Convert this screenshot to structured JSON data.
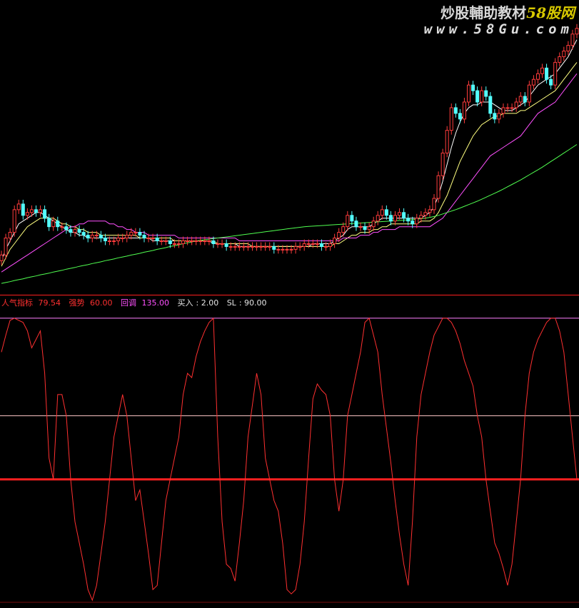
{
  "watermark": {
    "site_cn": "炒股輔助教材",
    "site_num": "58",
    "site_cn2": "股网",
    "url": "www.58Gu.com"
  },
  "colors": {
    "background": "#000000",
    "up_candle": "#ff3c3c",
    "down_candle": "#54ffff",
    "ma_short": "#ffffff",
    "ma_mid": "#ffff80",
    "ma_long": "#ff50ff",
    "ma_longest": "#50ff50",
    "indicator": "#ff3030",
    "level_line": "#ff2020",
    "ref_line": "#ffc8c8",
    "top_line": "#ff80ff",
    "divider": "#ff2020"
  },
  "legend": {
    "name_label": "人气指标",
    "name_value": "79.54",
    "strong_label": "强势",
    "strong_value": "60.00",
    "pullback_label": "回调",
    "pullback_value": "135.00",
    "buy_label": "买入",
    "buy_value": "2.00",
    "sl_label": "SL",
    "sl_value": "90.00"
  },
  "chart_data": [
    {
      "type": "candlestick",
      "title": "",
      "ylim": [
        0,
        100
      ],
      "x": [
        0,
        1,
        2,
        3,
        4,
        5,
        6,
        7,
        8,
        9,
        10,
        11,
        12,
        13,
        14,
        15,
        16,
        17,
        18,
        19,
        20,
        21,
        22,
        23,
        24,
        25,
        26,
        27,
        28,
        29,
        30,
        31,
        32,
        33,
        34,
        35,
        36,
        37,
        38,
        39,
        40,
        41,
        42,
        43,
        44,
        45,
        46,
        47,
        48,
        49,
        50,
        51,
        52,
        53,
        54,
        55,
        56,
        57,
        58,
        59,
        60,
        61,
        62,
        63,
        64,
        65,
        66,
        67,
        68,
        69,
        70,
        71,
        72,
        73,
        74,
        75,
        76,
        77,
        78,
        79,
        80,
        81,
        82,
        83,
        84,
        85,
        86,
        87,
        88,
        89,
        90,
        91,
        92,
        93,
        94,
        95,
        96,
        97,
        98,
        99,
        100,
        101,
        102,
        103,
        104,
        105,
        106,
        107,
        108,
        109,
        110,
        111,
        112,
        113,
        114,
        115,
        116,
        117,
        118,
        119,
        120,
        121,
        122,
        123,
        124,
        125,
        126,
        127,
        128,
        129,
        130,
        131,
        132,
        133
      ],
      "close": [
        12,
        18,
        20,
        28,
        30,
        26,
        27,
        28,
        27,
        28,
        25,
        22,
        24,
        22,
        22,
        21,
        20,
        21,
        20,
        19,
        18,
        19,
        19,
        18,
        17,
        17,
        17,
        18,
        18,
        19,
        20,
        20,
        19,
        18,
        18,
        18,
        17,
        17,
        17,
        16,
        16,
        16,
        17,
        17,
        17,
        17,
        17,
        17,
        17,
        16,
        16,
        16,
        15,
        15,
        15,
        15,
        15,
        15,
        15,
        15,
        15,
        15,
        15,
        14,
        14,
        14,
        14,
        14,
        15,
        15,
        16,
        16,
        16,
        16,
        15,
        15,
        16,
        18,
        20,
        22,
        26,
        24,
        22,
        22,
        21,
        22,
        24,
        26,
        28,
        26,
        24,
        26,
        27,
        25,
        24,
        23,
        25,
        26,
        27,
        28,
        32,
        40,
        48,
        56,
        64,
        62,
        60,
        66,
        72,
        70,
        66,
        70,
        68,
        62,
        60,
        62,
        64,
        64,
        64,
        66,
        68,
        66,
        72,
        74,
        76,
        78,
        74,
        72,
        80,
        82,
        84,
        86,
        90,
        92
      ],
      "series": [
        {
          "name": "",
          "values": [
            10,
            14,
            17,
            20,
            23,
            24,
            25,
            26,
            27,
            27,
            26,
            25,
            24,
            23,
            22,
            21,
            20,
            20,
            19,
            19,
            18,
            18,
            18,
            18,
            18,
            18,
            18,
            18,
            18,
            18,
            18,
            18,
            18,
            18,
            18,
            17,
            17,
            17,
            17,
            17,
            17,
            17,
            17,
            17,
            17,
            17,
            17,
            17,
            17,
            16,
            16,
            16,
            16,
            16,
            16,
            15,
            15,
            15,
            15,
            15,
            15,
            15,
            15,
            15,
            15,
            15,
            15,
            15,
            15,
            15,
            15,
            15,
            16,
            16,
            16,
            16,
            16,
            17,
            18,
            19,
            21,
            22,
            22,
            22,
            22,
            22,
            23,
            24,
            25,
            25,
            25,
            25,
            25,
            25,
            25,
            25,
            25,
            25,
            26,
            27,
            29,
            33,
            38,
            44,
            50,
            55,
            59,
            62,
            64,
            65,
            65,
            66,
            66,
            66,
            65,
            64,
            63,
            63,
            63,
            64,
            65,
            66,
            68,
            70,
            72,
            73,
            74,
            75,
            76,
            78,
            80,
            82,
            85,
            88
          ]
        },
        {
          "name": "",
          "values": [
            8,
            11,
            14,
            16,
            18,
            20,
            22,
            23,
            24,
            25,
            25,
            25,
            25,
            24,
            23,
            23,
            22,
            22,
            21,
            21,
            20,
            20,
            20,
            19,
            19,
            19,
            19,
            19,
            19,
            19,
            19,
            19,
            18,
            18,
            18,
            18,
            18,
            18,
            18,
            18,
            17,
            17,
            17,
            17,
            17,
            17,
            17,
            17,
            17,
            17,
            16,
            16,
            16,
            16,
            16,
            16,
            16,
            16,
            15,
            15,
            15,
            15,
            15,
            15,
            15,
            15,
            15,
            15,
            15,
            15,
            15,
            15,
            15,
            15,
            15,
            15,
            15,
            16,
            16,
            17,
            18,
            19,
            19,
            20,
            20,
            20,
            21,
            21,
            22,
            22,
            23,
            23,
            23,
            23,
            23,
            23,
            23,
            24,
            24,
            24,
            25,
            27,
            30,
            33,
            37,
            41,
            45,
            48,
            51,
            54,
            56,
            58,
            59,
            60,
            61,
            61,
            62,
            62,
            62,
            62,
            63,
            63,
            64,
            65,
            66,
            67,
            68,
            69,
            70,
            72,
            74,
            76,
            78,
            80
          ]
        },
        {
          "name": "",
          "values": [
            6,
            7,
            8,
            9,
            10,
            11,
            12,
            13,
            14,
            15,
            16,
            17,
            18,
            19,
            20,
            21,
            22,
            22,
            23,
            23,
            24,
            24,
            24,
            24,
            24,
            23,
            23,
            22,
            22,
            21,
            21,
            20,
            20,
            20,
            19,
            19,
            19,
            19,
            19,
            19,
            19,
            18,
            18,
            18,
            18,
            18,
            18,
            18,
            18,
            18,
            18,
            18,
            18,
            18,
            18,
            17,
            17,
            17,
            17,
            17,
            17,
            17,
            17,
            17,
            17,
            17,
            17,
            17,
            17,
            17,
            17,
            17,
            17,
            17,
            17,
            17,
            17,
            17,
            17,
            18,
            18,
            18,
            18,
            19,
            19,
            19,
            20,
            20,
            21,
            21,
            21,
            21,
            22,
            22,
            22,
            22,
            22,
            22,
            22,
            22,
            23,
            24,
            25,
            27,
            29,
            31,
            33,
            35,
            37,
            39,
            41,
            43,
            45,
            47,
            48,
            49,
            50,
            51,
            52,
            53,
            54,
            56,
            58,
            60,
            62,
            63,
            64,
            65,
            66,
            68,
            70,
            72,
            74,
            76
          ]
        },
        {
          "name": "",
          "values": [
            2,
            2.3,
            2.6,
            3,
            3.3,
            3.6,
            4,
            4.3,
            4.6,
            5,
            5.3,
            5.6,
            6,
            6.3,
            6.6,
            7,
            7.3,
            7.6,
            8,
            8.3,
            8.6,
            9,
            9.3,
            9.6,
            10,
            10.3,
            10.6,
            11,
            11.3,
            11.6,
            12,
            12.3,
            12.6,
            13,
            13.3,
            13.6,
            14,
            14.3,
            14.6,
            15,
            15.3,
            15.6,
            16,
            16.3,
            16.6,
            17,
            17.2,
            17.4,
            17.6,
            17.8,
            18,
            18.2,
            18.4,
            18.6,
            18.8,
            19,
            19.2,
            19.4,
            19.6,
            19.8,
            20,
            20.2,
            20.4,
            20.6,
            20.8,
            21,
            21.2,
            21.4,
            21.6,
            21.8,
            22,
            22.1,
            22.2,
            22.3,
            22.4,
            22.5,
            22.6,
            22.7,
            22.8,
            22.9,
            23,
            23.1,
            23.2,
            23.3,
            23.4,
            23.5,
            23.6,
            23.7,
            23.8,
            23.9,
            24,
            24.1,
            24.2,
            24.3,
            24.4,
            24.5,
            24.6,
            24.8,
            25,
            25.3,
            25.6,
            26,
            26.5,
            27,
            27.5,
            28,
            28.6,
            29.2,
            29.8,
            30.4,
            31,
            31.7,
            32.4,
            33.1,
            33.8,
            34.5,
            35.3,
            36.1,
            36.9,
            37.7,
            38.5,
            39.4,
            40.3,
            41.2,
            42.1,
            43,
            44,
            45,
            46,
            47,
            48,
            49,
            50,
            51
          ]
        }
      ]
    },
    {
      "type": "line",
      "title": "",
      "ylim": [
        0,
        140
      ],
      "x": [
        0,
        1,
        2,
        3,
        4,
        5,
        6,
        7,
        8,
        9,
        10,
        11,
        12,
        13,
        14,
        15,
        16,
        17,
        18,
        19,
        20,
        21,
        22,
        23,
        24,
        25,
        26,
        27,
        28,
        29,
        30,
        31,
        32,
        33,
        34,
        35,
        36,
        37,
        38,
        39,
        40,
        41,
        42,
        43,
        44,
        45,
        46,
        47,
        48,
        49,
        50,
        51,
        52,
        53,
        54,
        55,
        56,
        57,
        58,
        59,
        60,
        61,
        62,
        63,
        64,
        65,
        66,
        67,
        68,
        69,
        70,
        71,
        72,
        73,
        74,
        75,
        76,
        77,
        78,
        79,
        80,
        81,
        82,
        83,
        84,
        85,
        86,
        87,
        88,
        89,
        90,
        91,
        92,
        93,
        94,
        95,
        96,
        97,
        98,
        99,
        100,
        101,
        102,
        103,
        104,
        105,
        106,
        107,
        108,
        109,
        110,
        111,
        112,
        113,
        114,
        115,
        116,
        117,
        118,
        119,
        120,
        121,
        122,
        123,
        124,
        125,
        126,
        127,
        128,
        129,
        130,
        131,
        132,
        133
      ],
      "series": [
        {
          "name": "人气指标",
          "values": [
            120,
            128,
            135,
            136,
            135,
            134,
            130,
            122,
            126,
            130,
            110,
            70,
            60,
            100,
            100,
            90,
            60,
            40,
            30,
            20,
            8,
            3,
            10,
            25,
            40,
            60,
            80,
            90,
            100,
            90,
            70,
            50,
            55,
            40,
            25,
            8,
            10,
            30,
            50,
            60,
            70,
            80,
            100,
            110,
            108,
            118,
            125,
            130,
            134,
            136,
            80,
            40,
            20,
            18,
            12,
            30,
            50,
            80,
            95,
            110,
            100,
            70,
            60,
            50,
            45,
            30,
            8,
            6,
            8,
            20,
            40,
            70,
            98,
            105,
            102,
            100,
            90,
            60,
            45,
            60,
            90,
            100,
            110,
            120,
            134,
            136,
            128,
            120,
            100,
            84,
            68,
            50,
            34,
            20,
            10,
            40,
            80,
            100,
            110,
            120,
            128,
            132,
            136,
            136,
            134,
            130,
            124,
            116,
            110,
            104,
            90,
            80,
            60,
            45,
            30,
            25,
            18,
            10,
            20,
            40,
            60,
            90,
            110,
            120,
            126,
            130,
            134,
            136,
            136,
            130,
            120,
            100,
            80,
            60
          ]
        },
        {
          "name": "强势",
          "values": [
            60
          ]
        },
        {
          "name": "买入",
          "values": [
            2
          ]
        },
        {
          "name": "SL",
          "values": [
            90
          ]
        }
      ]
    }
  ]
}
